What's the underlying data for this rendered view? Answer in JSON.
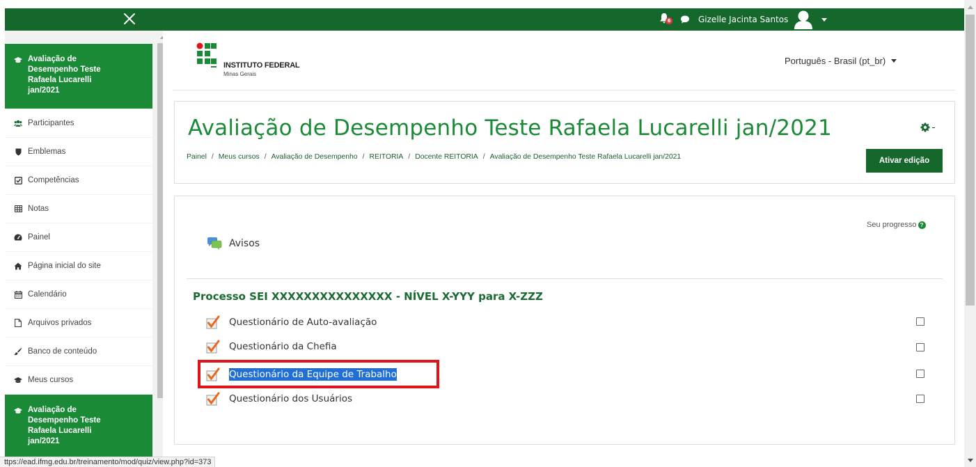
{
  "navbar": {
    "close_label": "×",
    "notification_count": "6",
    "user_name": "Gizelle Jacinta Santos"
  },
  "sidebar": {
    "items": [
      {
        "label": "Avaliação de Desempenho Teste Rafaela Lucarelli jan/2021",
        "icon": "graduation-cap-icon"
      },
      {
        "label": "Participantes",
        "icon": "users-icon"
      },
      {
        "label": "Emblemas",
        "icon": "shield-icon"
      },
      {
        "label": "Competências",
        "icon": "check-square-icon"
      },
      {
        "label": "Notas",
        "icon": "table-icon"
      },
      {
        "label": "Painel",
        "icon": "dashboard-icon"
      },
      {
        "label": "Página inicial do site",
        "icon": "home-icon"
      },
      {
        "label": "Calendário",
        "icon": "calendar-icon"
      },
      {
        "label": "Arquivos privados",
        "icon": "file-icon"
      },
      {
        "label": "Banco de conteúdo",
        "icon": "brush-icon"
      },
      {
        "label": "Meus cursos",
        "icon": "graduation-cap-icon"
      },
      {
        "label": "Avaliação de Desempenho Teste Rafaela Lucarelli jan/2021",
        "icon": "graduation-cap-icon"
      }
    ]
  },
  "header": {
    "logo_name": "INSTITUTO FEDERAL",
    "logo_sub": "Minas Gerais",
    "language": "Português - Brasil (pt_br)"
  },
  "course": {
    "title": "Avaliação de Desempenho Teste Rafaela Lucarelli jan/2021",
    "breadcrumb": [
      "Painel",
      "Meus cursos",
      "Avaliação de Desempenho",
      "REITORIA",
      "Docente REITORIA",
      "Avaliação de Desempenho Teste Rafaela Lucarelli jan/2021"
    ],
    "edit_button": "Ativar edição"
  },
  "content": {
    "progress_label": "Seu progresso",
    "progress_help": "?",
    "announcements": "Avisos",
    "section_title": "Processo SEI XXXXXXXXXXXXXXX - NÍVEL X-YYY para X-ZZZ",
    "activities": [
      {
        "label": "Questionário de Auto-avaliação",
        "completed": false
      },
      {
        "label": "Questionário da Chefia",
        "completed": false
      },
      {
        "label": "Questionário da Equipe de Trabalho",
        "completed": false,
        "selected": true
      },
      {
        "label": "Questionário dos Usuários",
        "completed": false
      }
    ]
  },
  "status_bar": {
    "url": "ttps://ead.ifmg.edu.br/treinamento/mod/quiz/view.php?id=373"
  },
  "colors": {
    "brand_green": "#15672b",
    "sidebar_active": "#1b8a36",
    "highlight_red": "#e0141b",
    "selection_blue": "#1f6fd6"
  }
}
